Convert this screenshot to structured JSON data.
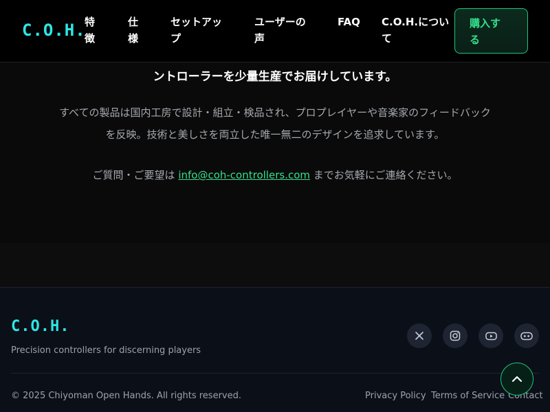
{
  "brand": {
    "logo": "C.O.H."
  },
  "nav": {
    "items": [
      {
        "line1": "特",
        "line2": "徴"
      },
      {
        "line1": "仕",
        "line2": "様"
      },
      {
        "line1": "セットアッ",
        "line2": "プ"
      },
      {
        "line1": "ユーザーの",
        "line2": "声"
      },
      {
        "line1": "FAQ",
        "line2": ""
      },
      {
        "line1": "C.O.H.につい",
        "line2": "て"
      }
    ],
    "buy": {
      "line1": "購入す",
      "line2": "る"
    }
  },
  "about": {
    "lead": "ントローラーを少量生産でお届けしています。",
    "body_line1": "すべての製品は国内工房で設計・組立・検品され、プロプレイヤーや音楽家のフィードバック",
    "body_line2": "を反映。技術と美しさを両立した唯一無二のデザインを追求しています。",
    "contact_prefix": "ご質問・ご要望は",
    "contact_email": "info@coh-controllers.com",
    "contact_suffix": "までお気軽にご連絡ください。"
  },
  "footer": {
    "logo": "C.O.H.",
    "tagline": "Precision controllers for discerning players",
    "social": [
      "x-icon",
      "instagram-icon",
      "youtube-icon",
      "discord-icon"
    ],
    "copyright": "© 2025 Chiyoman Open Hands. All rights reserved.",
    "links": {
      "privacy": "Privacy Policy",
      "terms": "Terms of Service",
      "contact": "Contact"
    }
  },
  "colors": {
    "accent_cyan": "#2ee6e6",
    "accent_green": "#34e08c",
    "header_bg": "#000000",
    "body_bg": "#0a0a0a",
    "footer_bg": "#0b0f17"
  }
}
